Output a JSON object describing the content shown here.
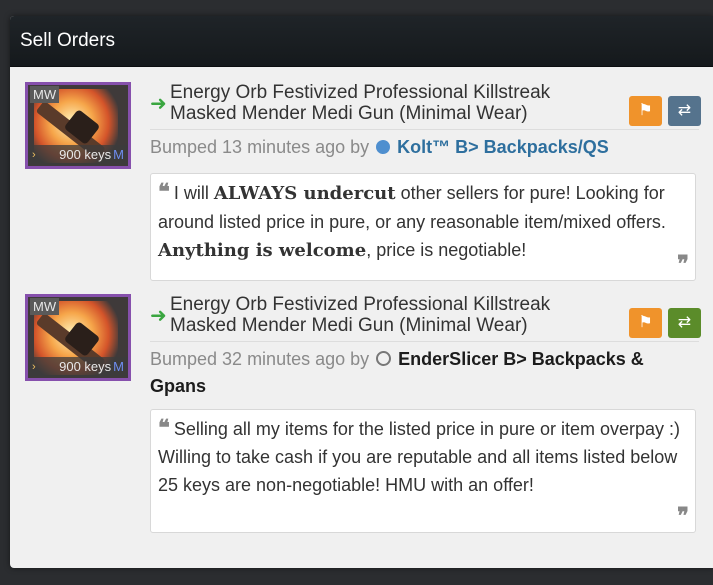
{
  "panel": {
    "title": "Sell Orders"
  },
  "listings": [
    {
      "quality": "MW",
      "price": "900 keys",
      "price_suffix": "M",
      "title": "Energy Orb Festivized Professional Killstreak Masked Mender Medi Gun (Minimal Wear)",
      "bumped": "Bumped 13 minutes ago by",
      "user": "Kolt™ B> Backpacks/QS",
      "user_color": "#2e6f9e",
      "status": "online",
      "trade_button_color": "#55738d",
      "desc_parts": [
        "I will ",
        "ALWAYS undercut",
        " other sellers for pure! Looking for around listed price in pure, or any reasonable item/mixed offers. ",
        "Anything is welcome",
        ", price is negotiable!"
      ]
    },
    {
      "quality": "MW",
      "price": "900 keys",
      "price_suffix": "M",
      "title": "Energy Orb Festivized Professional Killstreak Masked Mender Medi Gun (Minimal Wear)",
      "bumped": "Bumped 32 minutes ago by",
      "user": "EnderSlicer B> Backpacks & Gpans",
      "user_color": "#1c1c1c",
      "status": "offline",
      "trade_button_color": "#5b8c2a",
      "desc": "Selling all my items for the listed price in pure or item overpay :) Willing to take cash if you are reputable and all items listed below 25 keys are non-negotiable! HMU with an offer!"
    }
  ],
  "icons": {
    "flag": "flag-icon",
    "trade": "exchange-icon",
    "arrow": "arrow-right-icon",
    "quote_open": "quote-open-icon",
    "quote_close": "quote-close-icon"
  }
}
